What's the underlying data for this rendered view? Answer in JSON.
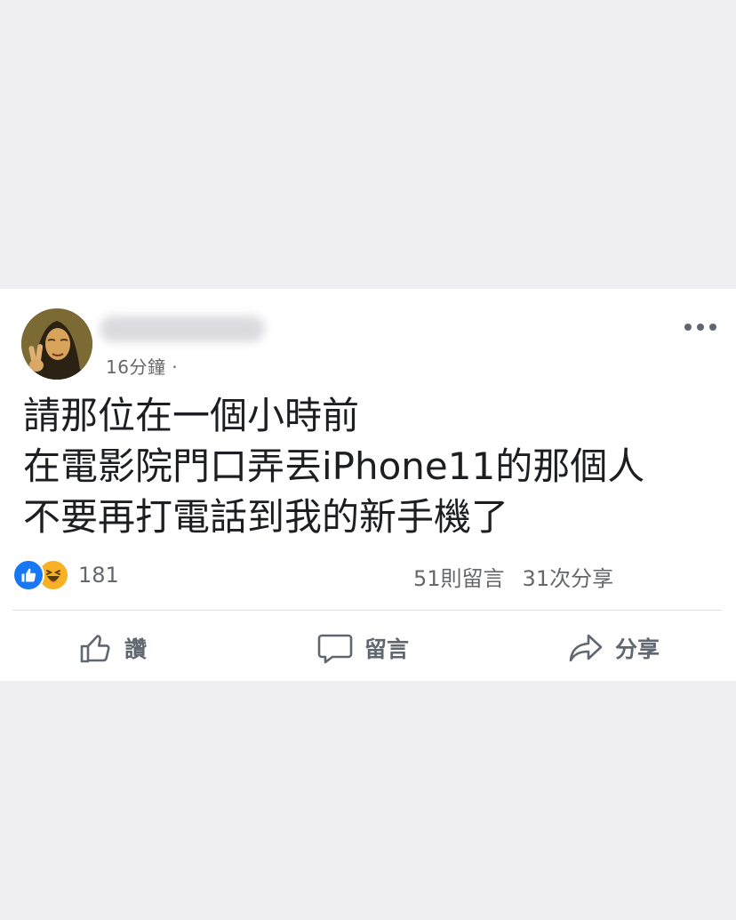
{
  "post": {
    "author_name_blurred": true,
    "timestamp": "16分鐘 ·",
    "text_lines": [
      "請那位在一個小時前",
      "在電影院門口弄丟iPhone11的那個人",
      "不要再打電話到我的新手機了"
    ],
    "reactions": {
      "icons": [
        "like-icon",
        "haha-icon"
      ],
      "count": "181"
    },
    "comments": "51則留言",
    "shares": "31次分享"
  },
  "actions": {
    "like_label": "讚",
    "comment_label": "留言",
    "share_label": "分享"
  },
  "colors": {
    "like_blue": "#1877f2",
    "haha_yellow": "#f7b125",
    "secondary_text": "#65676b",
    "page_background": "#efeef3"
  }
}
